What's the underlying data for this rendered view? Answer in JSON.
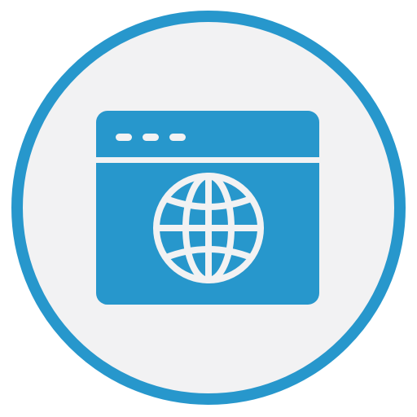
{
  "icon": {
    "name": "web-browser-globe-icon",
    "colors": {
      "ring": "#2797CC",
      "disc": "#F2F2F3",
      "window": "#2797CC",
      "foreground": "#F2F2F3"
    }
  }
}
